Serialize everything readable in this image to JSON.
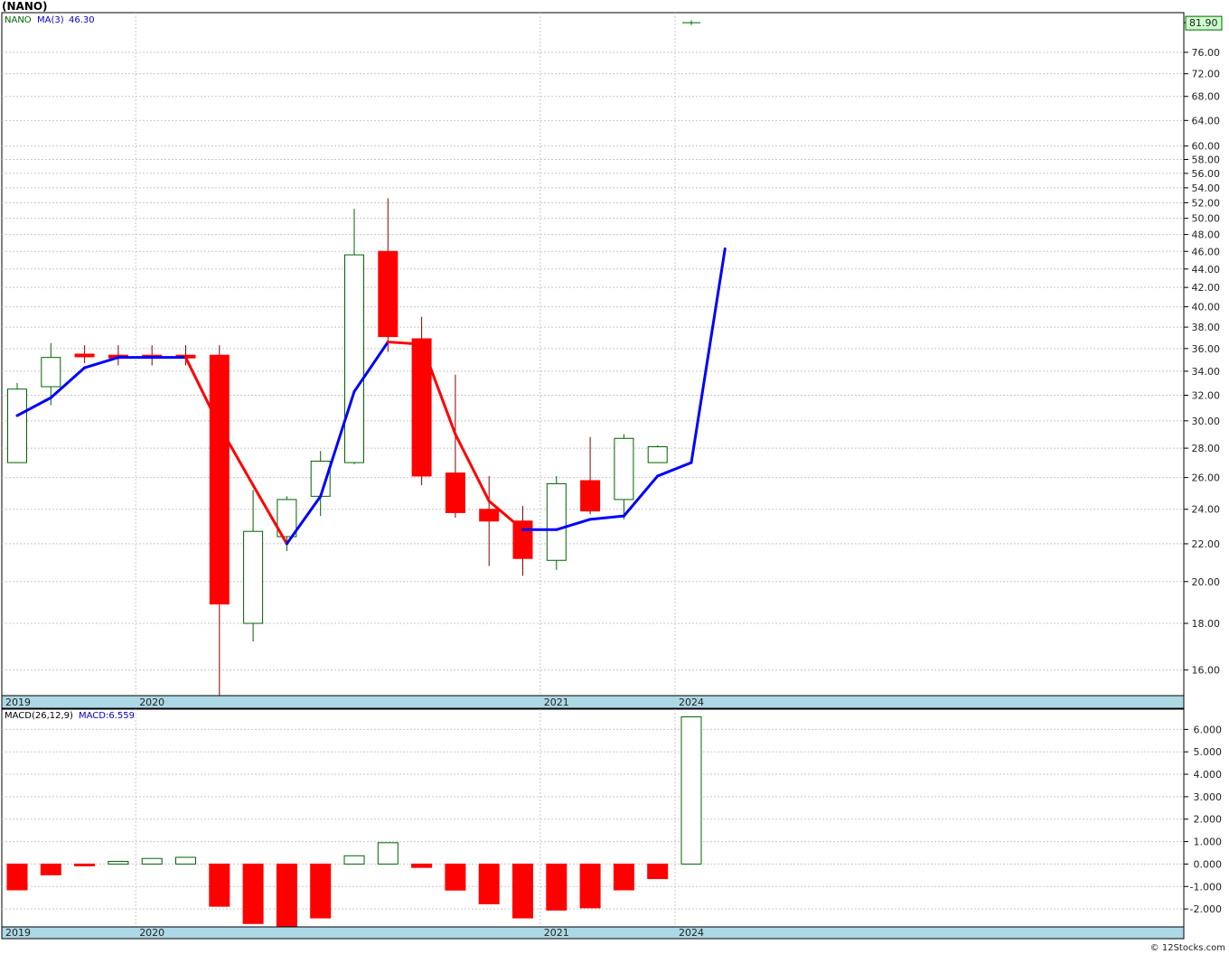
{
  "header": {
    "title": "(NANO)"
  },
  "footer": {
    "credit": "© 12Stocks.com"
  },
  "colors": {
    "up": "#006400",
    "down": "#ff0000",
    "ma_down": "#ff0000",
    "ma_up": "#0000ff",
    "axis_band": "#add8e6",
    "grid": "#c8c8c8",
    "last_price_box": "#ccffcc"
  },
  "legend": {
    "price_symbol": "NANO",
    "ma_label": "MA(3)",
    "ma_value": "46.30",
    "macd_label": "MACD(26,12,9)",
    "macd_value": "MACD:6.559"
  },
  "chart_data": [
    {
      "type": "candlestick",
      "scale": "log",
      "ylim": [
        15,
        84
      ],
      "last_price_label": "81.90",
      "y_ticks": [
        "16.00",
        "18.00",
        "20.00",
        "22.00",
        "24.00",
        "26.00",
        "28.00",
        "30.00",
        "32.00",
        "34.00",
        "36.00",
        "38.00",
        "40.00",
        "42.00",
        "44.00",
        "46.00",
        "48.00",
        "50.00",
        "52.00",
        "54.00",
        "56.00",
        "58.00",
        "60.00",
        "64.00",
        "68.00",
        "72.00",
        "76.00"
      ],
      "x_labels": [
        {
          "index": 0,
          "label": "2019"
        },
        {
          "index": 4,
          "label": "2020"
        },
        {
          "index": 16,
          "label": "2021"
        },
        {
          "index": 20,
          "label": "2024"
        }
      ],
      "candles": [
        {
          "o": 27.0,
          "h": 33.0,
          "l": 27.0,
          "c": 32.5
        },
        {
          "o": 32.7,
          "h": 36.5,
          "l": 31.2,
          "c": 35.2
        },
        {
          "o": 35.5,
          "h": 36.3,
          "l": 34.7,
          "c": 35.3
        },
        {
          "o": 35.4,
          "h": 36.3,
          "l": 34.5,
          "c": 35.2
        },
        {
          "o": 35.4,
          "h": 36.3,
          "l": 34.5,
          "c": 35.2
        },
        {
          "o": 35.4,
          "h": 36.3,
          "l": 34.5,
          "c": 35.2
        },
        {
          "o": 35.4,
          "h": 36.3,
          "l": 14.9,
          "c": 18.9
        },
        {
          "o": 18.0,
          "h": 25.2,
          "l": 17.2,
          "c": 22.7
        },
        {
          "o": 22.4,
          "h": 24.8,
          "l": 21.6,
          "c": 24.6
        },
        {
          "o": 24.8,
          "h": 27.8,
          "l": 23.6,
          "c": 27.1
        },
        {
          "o": 27.0,
          "h": 51.2,
          "l": 26.9,
          "c": 45.6
        },
        {
          "o": 46.0,
          "h": 52.6,
          "l": 35.7,
          "c": 37.1
        },
        {
          "o": 36.9,
          "h": 39.0,
          "l": 25.5,
          "c": 26.1
        },
        {
          "o": 26.3,
          "h": 33.7,
          "l": 23.5,
          "c": 23.8
        },
        {
          "o": 24.0,
          "h": 26.1,
          "l": 20.8,
          "c": 23.3
        },
        {
          "o": 23.3,
          "h": 24.2,
          "l": 20.3,
          "c": 21.2
        },
        {
          "o": 21.1,
          "h": 26.1,
          "l": 20.6,
          "c": 25.6
        },
        {
          "o": 25.8,
          "h": 28.8,
          "l": 23.7,
          "c": 23.9
        },
        {
          "o": 24.6,
          "h": 29.0,
          "l": 23.4,
          "c": 28.7
        },
        {
          "o": 27.0,
          "h": 28.2,
          "l": 27.0,
          "c": 28.1
        },
        {
          "o": 81.9,
          "h": 82.4,
          "l": 81.4,
          "c": 81.9
        }
      ],
      "ma3": [
        30.4,
        31.8,
        34.3,
        35.2,
        35.2,
        35.2,
        29.6,
        25.5,
        22.0,
        24.8,
        32.3,
        36.6,
        36.4,
        29.0,
        24.5,
        22.8,
        22.8,
        23.4,
        23.6,
        26.1,
        27.0,
        46.3
      ]
    },
    {
      "type": "bar",
      "ylim": [
        -2.8,
        6.9
      ],
      "y_ticks": [
        "6.000",
        "5.000",
        "4.000",
        "3.000",
        "2.000",
        "1.000",
        "0.000",
        "-1.000",
        "-2.000"
      ],
      "x_labels": [
        {
          "index": 0,
          "label": "2019"
        },
        {
          "index": 4,
          "label": "2020"
        },
        {
          "index": 16,
          "label": "2021"
        },
        {
          "index": 20,
          "label": "2024"
        }
      ],
      "values": [
        -1.15,
        -0.48,
        -0.08,
        0.12,
        0.25,
        0.3,
        -1.88,
        -2.65,
        -2.8,
        -2.4,
        0.37,
        0.95,
        -0.15,
        -1.16,
        -1.77,
        -2.4,
        -2.05,
        -1.95,
        -1.15,
        -0.65,
        6.559
      ]
    }
  ]
}
